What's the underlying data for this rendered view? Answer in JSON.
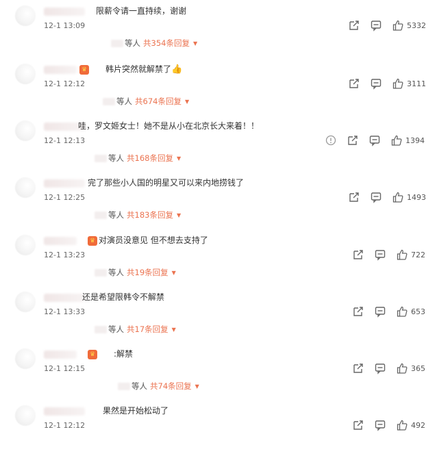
{
  "comments": [
    {
      "text": "限薪令请一直持续，谢谢",
      "time": "12-1 13:09",
      "likes": "5332",
      "replies_who": "等人",
      "replies_count": "共354条回复",
      "has_badge": false,
      "has_warn": false
    },
    {
      "text": "韩片突然就解禁了",
      "time": "12-1 12:12",
      "likes": "3111",
      "replies_who": "等人",
      "replies_count": "共674条回复",
      "has_badge": true,
      "has_warn": false,
      "emoji": "👍"
    },
    {
      "text": "哇，罗文姬女士！她不是从小在北京长大来着！！",
      "time": "12-1 12:13",
      "likes": "1394",
      "replies_who": "等人",
      "replies_count": "共168条回复",
      "has_badge": false,
      "has_warn": true
    },
    {
      "text": "完了那些小人国的明星又可以来内地捞钱了",
      "time": "12-1 12:25",
      "likes": "1493",
      "replies_who": "等人",
      "replies_count": "共183条回复",
      "has_badge": false,
      "has_warn": false
    },
    {
      "text": "对演员没意见 但不想去支持了",
      "time": "12-1 13:23",
      "likes": "722",
      "replies_who": "等人",
      "replies_count": "共19条回复",
      "has_badge": true,
      "has_warn": false
    },
    {
      "text": "还是希望限韩令不解禁",
      "time": "12-1 13:33",
      "likes": "653",
      "replies_who": "等人",
      "replies_count": "共17条回复",
      "has_badge": false,
      "has_warn": false
    },
    {
      "text": ":解禁",
      "time": "12-1 12:15",
      "likes": "365",
      "replies_who": "等人",
      "replies_count": "共74条回复",
      "has_badge": true,
      "has_warn": false
    },
    {
      "text": "果然是开始松动了",
      "time": "12-1 12:12",
      "likes": "492",
      "has_badge": false,
      "has_warn": false
    }
  ],
  "icons": {
    "share": "share-icon",
    "comment": "comment-icon",
    "like": "thumbs-up-icon",
    "warn": "warning-icon",
    "reply_arrow": "chevron-down-icon"
  },
  "colors": {
    "reply_count": "#eb7350",
    "badge": "#f06b3a",
    "text": "#333333",
    "meta": "#666666"
  }
}
